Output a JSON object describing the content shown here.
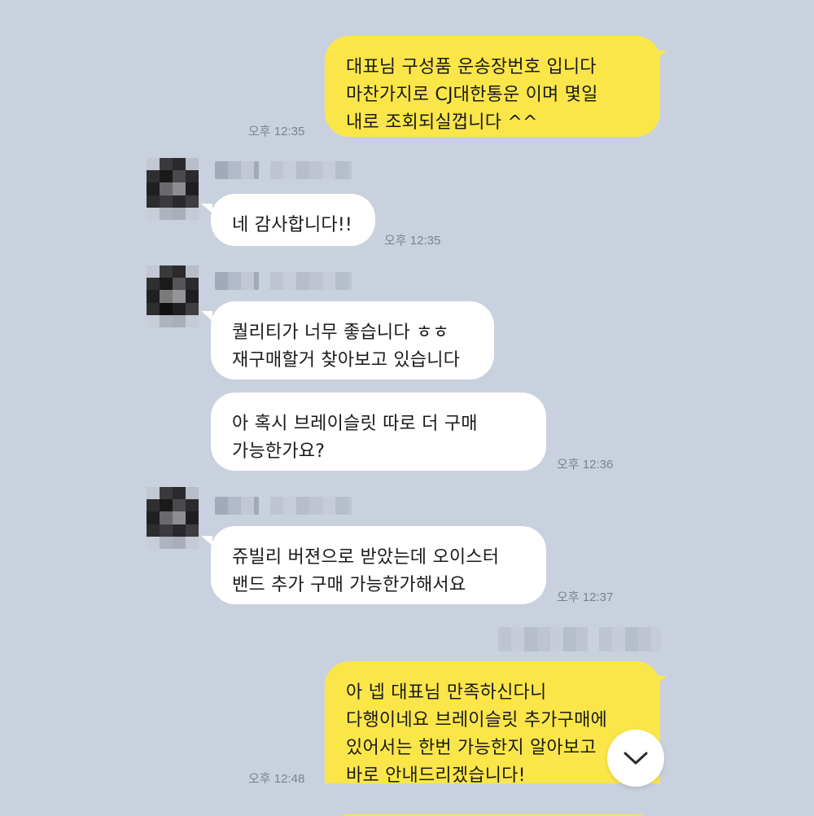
{
  "messages": [
    {
      "id": "m1",
      "sender": "me",
      "lines": [
        "대표님 구성품 운송장번호 입니다",
        "마찬가지로 CJ대한통운 이며 몇일",
        "내로 조회되실껍니다 ^^"
      ],
      "time": "오후 12:35"
    },
    {
      "id": "m2",
      "sender": "other",
      "lines": [
        "네 감사합니다!!"
      ],
      "time": "오후 12:35"
    },
    {
      "id": "m3",
      "sender": "other",
      "lines": [
        "퀄리티가 너무 좋습니다 ㅎㅎ",
        "재구매할거 찾아보고 있습니다"
      ],
      "time": ""
    },
    {
      "id": "m4",
      "sender": "other",
      "lines": [
        "아 혹시 브레이슬릿 따로 더 구매",
        "가능한가요?"
      ],
      "time": "오후 12:36"
    },
    {
      "id": "m5",
      "sender": "other",
      "lines": [
        "쥬빌리 버젼으로 받았는데 오이스터",
        "밴드 추가 구매 가능한가해서요"
      ],
      "time": "오후 12:37"
    },
    {
      "id": "m6",
      "sender": "me",
      "lines": [
        "아 넵 대표님 만족하신다니",
        "다행이네요 브레이슬릿 추가구매에",
        "있어서는 한번 가능한지 알아보고",
        "바로 안내드리겠습니다!"
      ],
      "time": "오후 12:48"
    }
  ],
  "colors": {
    "background": "#c9d1de",
    "my_bubble": "#fbe64a",
    "their_bubble": "#ffffff",
    "timestamp": "#7a8290"
  },
  "icons": {
    "scroll_down": "chevron-down-icon",
    "avatar": "pixelated-avatar"
  }
}
